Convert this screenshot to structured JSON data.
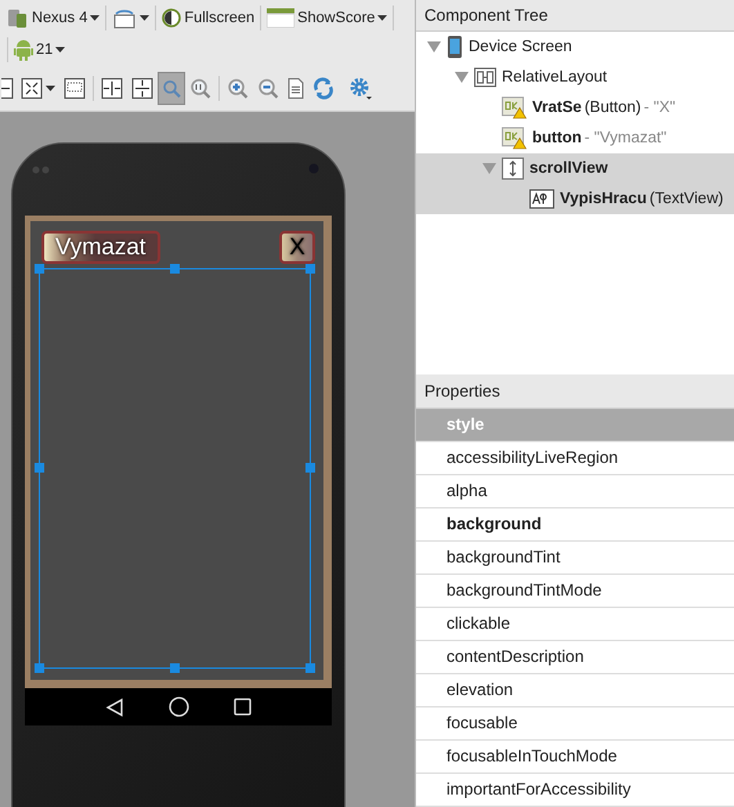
{
  "toolbar": {
    "device": "Nexus 4",
    "fullscreen": "Fullscreen",
    "theme": "ShowScore",
    "api": "21",
    "tools": [
      {
        "kind": "expand",
        "selected": false
      },
      {
        "kind": "fit",
        "selected": false
      },
      {
        "kind": "frame",
        "selected": false
      },
      {
        "kind": "shrink-h",
        "selected": false
      },
      {
        "kind": "shrink-v",
        "selected": false
      },
      {
        "kind": "zoom-actual",
        "selected": true
      },
      {
        "kind": "zoom-100",
        "selected": false
      },
      {
        "kind": "zoom-in",
        "selected": false
      },
      {
        "kind": "zoom-out",
        "selected": false
      },
      {
        "kind": "page",
        "selected": false
      },
      {
        "kind": "refresh",
        "selected": false
      },
      {
        "kind": "settings",
        "selected": false
      }
    ]
  },
  "preview": {
    "clear_button": "Vymazat",
    "close_button": "X"
  },
  "component_tree": {
    "title": "Component Tree",
    "nodes": [
      {
        "kind": "device",
        "name": "Device Screen",
        "expanded": true,
        "selected": false,
        "children": [
          {
            "kind": "layout",
            "name": "RelativeLayout",
            "expanded": true,
            "selected": false,
            "children": [
              {
                "kind": "button",
                "name": "VratSe",
                "type": "(Button)",
                "value": "- \"X\"",
                "warning": true,
                "selected": false
              },
              {
                "kind": "button",
                "name": "button",
                "value": "- \"Vymazat\"",
                "warning": true,
                "selected": false
              },
              {
                "kind": "scroll",
                "name": "scrollView",
                "expanded": true,
                "selected": true,
                "children": [
                  {
                    "kind": "text",
                    "name": "VypisHracu",
                    "type": "(TextView)",
                    "selected": true
                  }
                ]
              }
            ]
          }
        ]
      }
    ]
  },
  "properties": {
    "title": "Properties",
    "items": [
      {
        "name": "style",
        "modified": false,
        "selected": true
      },
      {
        "name": "accessibilityLiveRegion",
        "modified": false,
        "selected": false
      },
      {
        "name": "alpha",
        "modified": false,
        "selected": false
      },
      {
        "name": "background",
        "modified": true,
        "selected": false
      },
      {
        "name": "backgroundTint",
        "modified": false,
        "selected": false
      },
      {
        "name": "backgroundTintMode",
        "modified": false,
        "selected": false
      },
      {
        "name": "clickable",
        "modified": false,
        "selected": false
      },
      {
        "name": "contentDescription",
        "modified": false,
        "selected": false
      },
      {
        "name": "elevation",
        "modified": false,
        "selected": false
      },
      {
        "name": "focusable",
        "modified": false,
        "selected": false
      },
      {
        "name": "focusableInTouchMode",
        "modified": false,
        "selected": false
      },
      {
        "name": "importantForAccessibility",
        "modified": false,
        "selected": false
      }
    ]
  }
}
